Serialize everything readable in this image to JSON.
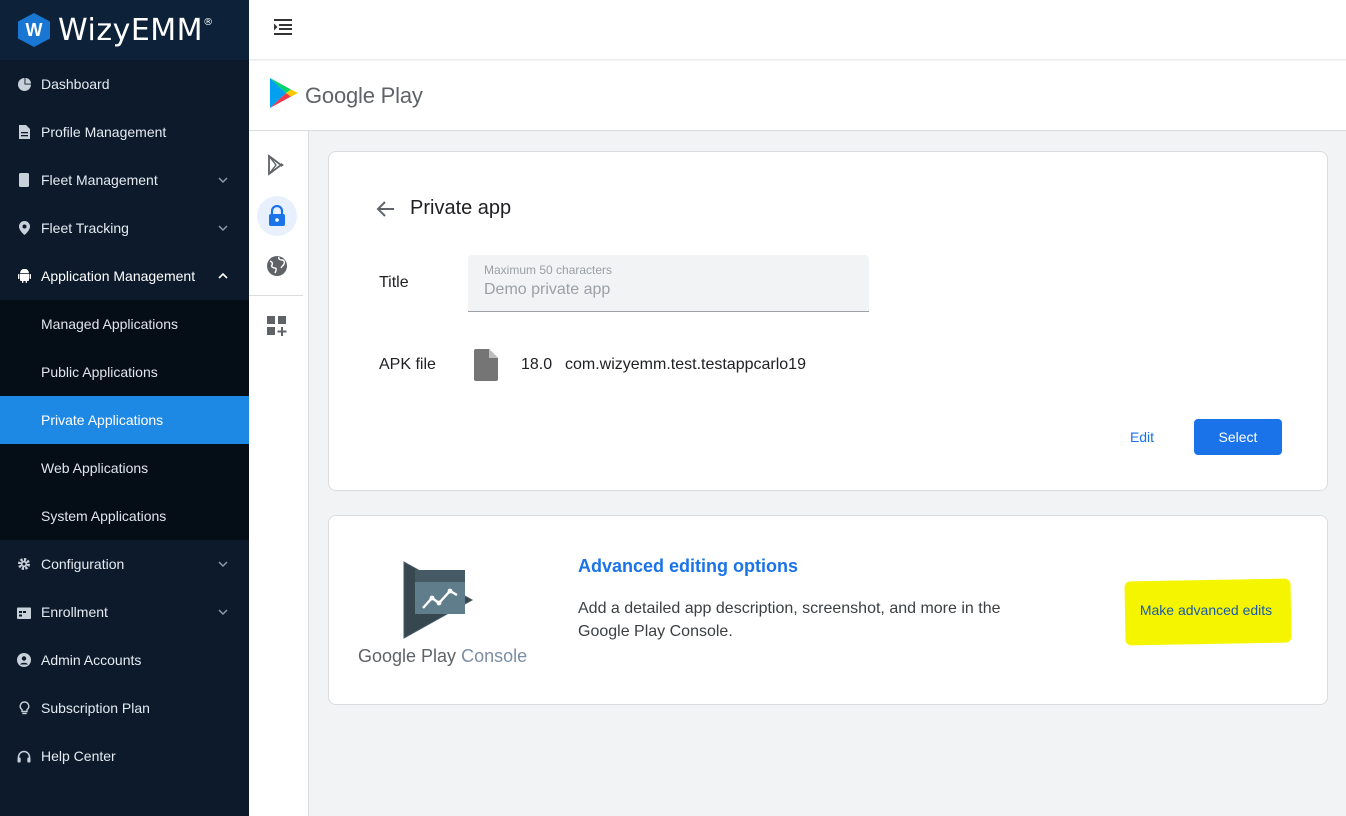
{
  "brand": {
    "letter": "W",
    "name": "WizyEMM",
    "mark": "®"
  },
  "sidebar": {
    "items": [
      {
        "label": "Dashboard"
      },
      {
        "label": "Profile Management"
      },
      {
        "label": "Fleet Management"
      },
      {
        "label": "Fleet Tracking"
      },
      {
        "label": "Application Management"
      },
      {
        "label": "Managed Applications"
      },
      {
        "label": "Public Applications"
      },
      {
        "label": "Private Applications"
      },
      {
        "label": "Web Applications"
      },
      {
        "label": "System Applications"
      },
      {
        "label": "Configuration"
      },
      {
        "label": "Enrollment"
      },
      {
        "label": "Admin Accounts"
      },
      {
        "label": "Subscription Plan"
      },
      {
        "label": "Help Center"
      }
    ],
    "active": "Private Applications"
  },
  "play_header": {
    "title": "Google Play"
  },
  "private_app": {
    "heading": "Private app",
    "title_label": "Title",
    "title_hint": "Maximum 50 characters",
    "title_value": "Demo private app",
    "apk_label": "APK file",
    "apk_version": "18.0",
    "apk_package": "com.wizyemm.test.testappcarlo19",
    "edit_label": "Edit",
    "select_label": "Select"
  },
  "advanced": {
    "logo_text_1": "Google Play",
    "logo_text_2": "Console",
    "title": "Advanced editing options",
    "description": "Add a detailed app description, screenshot, and more in the Google Play Console.",
    "button_label": "Make advanced edits"
  },
  "colors": {
    "sidebar_bg": "#0c1a2b",
    "active_item": "#1e88e5",
    "primary": "#1a73e8",
    "highlight": "#f5f500"
  }
}
